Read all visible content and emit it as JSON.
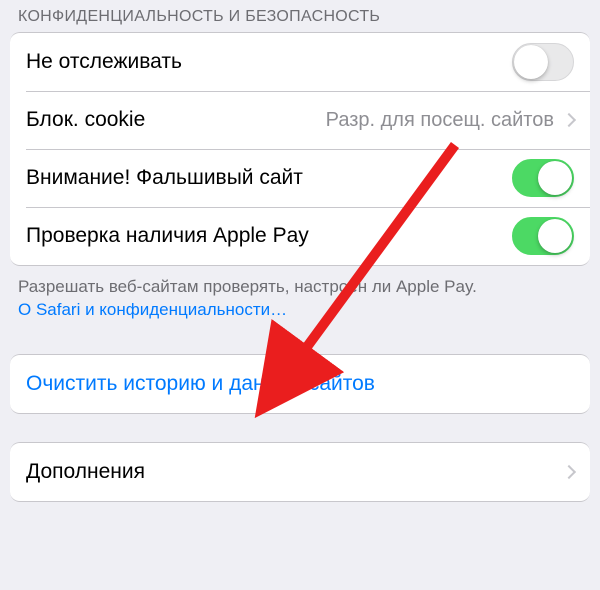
{
  "section_privacy": {
    "header": "КОНФИДЕНЦИАЛЬНОСТЬ И БЕЗОПАСНОСТЬ",
    "rows": {
      "do_not_track": {
        "label": "Не отслеживать",
        "on": false
      },
      "block_cookies": {
        "label": "Блок. cookie",
        "value": "Разр. для посещ. сайтов"
      },
      "fraud_warning": {
        "label": "Внимание! Фальшивый сайт",
        "on": true
      },
      "apple_pay_check": {
        "label": "Проверка наличия Apple Pay",
        "on": true
      }
    },
    "footer_text": "Разрешать веб-сайтам проверять, настроен ли Apple Pay.",
    "footer_link": "О Safari и конфиденциальности…"
  },
  "section_clear": {
    "action_label": "Очистить историю и данные сайтов"
  },
  "section_extensions": {
    "label": "Дополнения"
  },
  "colors": {
    "link": "#007aff",
    "switch_on": "#4cd964",
    "annotation": "#ea1e1e"
  }
}
